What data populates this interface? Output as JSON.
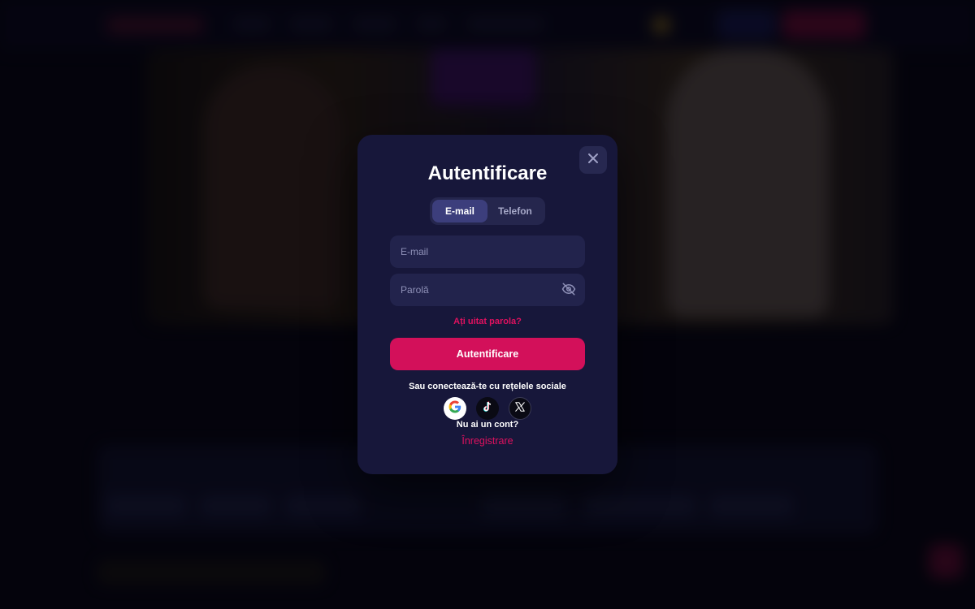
{
  "modal": {
    "title": "Autentificare",
    "tabs": [
      {
        "label": "E-mail",
        "active": true
      },
      {
        "label": "Telefon",
        "active": false
      }
    ],
    "email_placeholder": "E-mail",
    "password_placeholder": "Parolă",
    "forgot_label": "Ați uitat parola?",
    "submit_label": "Autentificare",
    "social_text": "Sau conectează-te cu rețelele sociale",
    "social_providers": [
      "google-icon",
      "tiktok-icon",
      "x-icon"
    ],
    "no_account_text": "Nu ai un cont?",
    "register_label": "Înregistrare"
  },
  "colors": {
    "accent": "#d3105a",
    "modal_bg": "#17173a",
    "field_bg": "#22234c",
    "active_tab": "#3c3e7c"
  }
}
